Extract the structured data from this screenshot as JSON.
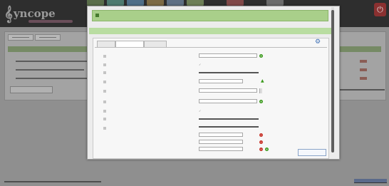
{
  "app": {
    "logo_text": "yncope",
    "logo_glyph": "𝄞",
    "logout_glyph": "⏻"
  },
  "colors": {
    "modal_header": "#a9cf8a",
    "section_bar": "#b9dda1",
    "add": "#3b9a1c",
    "delete": "#c8352b",
    "top_tabs": [
      "#5a6e4a",
      "#4e7a6f",
      "#4f6e88",
      "#7c6a45",
      "#5e6f83",
      "#6d7e56",
      "#804848",
      "#6b6b6b",
      "#566f7a"
    ]
  },
  "modal": {
    "header_title": "",
    "section_title": "",
    "tabs": [
      "",
      "",
      ""
    ],
    "top_right": "",
    "form_title": "",
    "rows": [
      {
        "label": "",
        "field": "",
        "action": "add"
      },
      {
        "label": "",
        "field": "",
        "action": "none"
      },
      {
        "label": "",
        "field": "",
        "action": "none"
      },
      {
        "label": "",
        "field": "",
        "action": "warn"
      },
      {
        "label": "",
        "field": "",
        "action": "none"
      },
      {
        "label": "",
        "field": "",
        "action": "add"
      },
      {
        "label": "",
        "field": "",
        "action": "none"
      },
      {
        "label": "",
        "field": "",
        "action": "none"
      },
      {
        "label": "",
        "field": "",
        "action": "delete"
      }
    ],
    "list_values": [
      "",
      "",
      ""
    ],
    "save_label": ""
  }
}
